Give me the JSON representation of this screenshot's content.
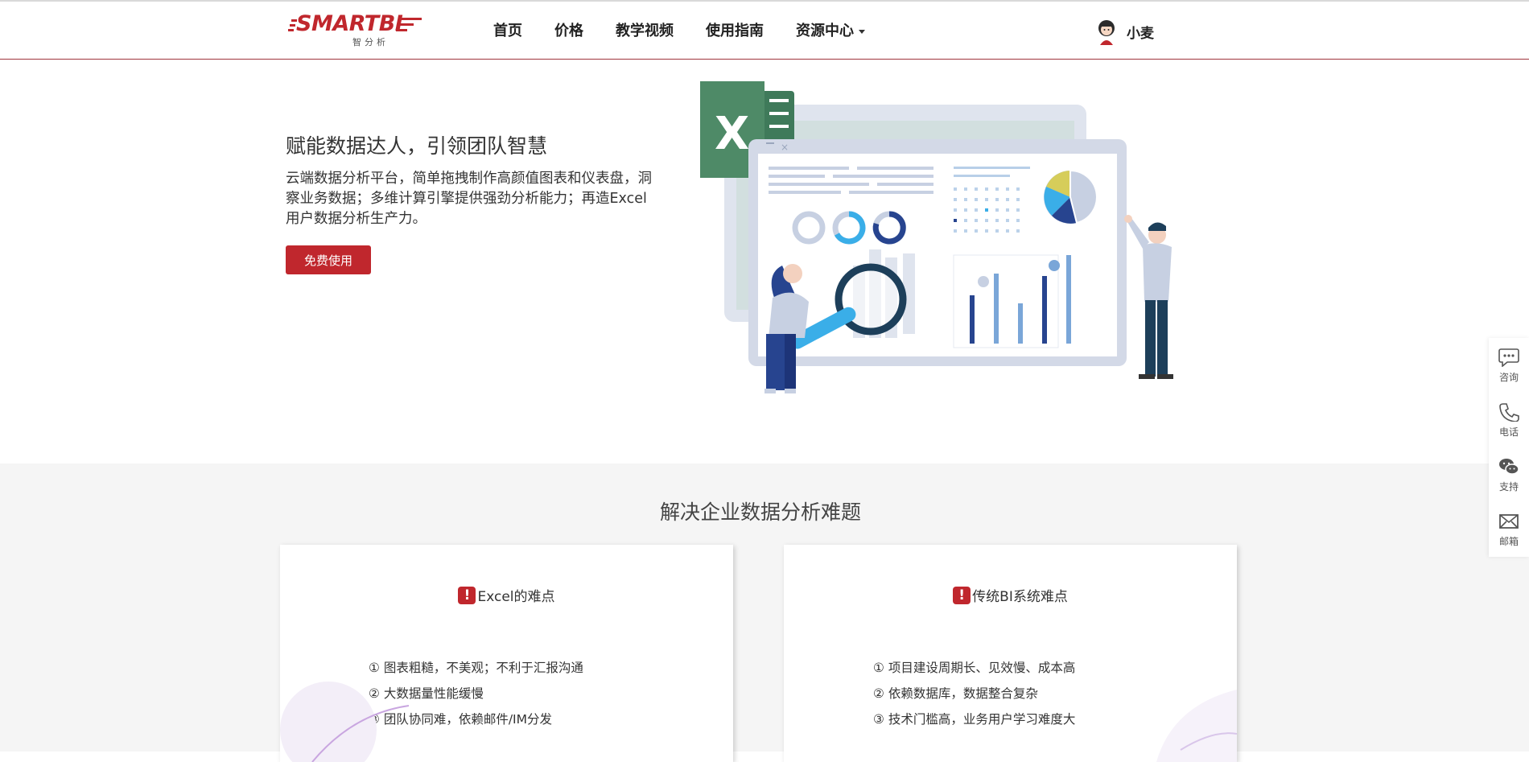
{
  "header": {
    "logo_text": "SMARTBI",
    "logo_sub": "智分析",
    "nav": [
      {
        "label": "首页"
      },
      {
        "label": "价格"
      },
      {
        "label": "教学视频"
      },
      {
        "label": "使用指南"
      },
      {
        "label": "资源中心"
      }
    ],
    "user_name": "小麦"
  },
  "hero": {
    "title": "赋能数据达人，引领团队智慧",
    "description": "云端数据分析平台，简单拖拽制作高颜值图表和仪表盘，洞察业务数据；多维计算引擎提供强劲分析能力；再造Excel用户数据分析生产力。",
    "button_label": "免费使用",
    "excel_icon_letter": "X"
  },
  "section": {
    "title": "解决企业数据分析难题",
    "cards": [
      {
        "title": "Excel的难点",
        "items": [
          "① 图表粗糙，不美观；不利于汇报沟通",
          "② 大数据量性能缓慢",
          "③ 团队协同难，依赖邮件/IM分发"
        ]
      },
      {
        "title": "传统BI系统难点",
        "items": [
          "① 项目建设周期长、见效慢、成本高",
          "② 依赖数据库，数据整合复杂",
          "③ 技术门槛高，业务用户学习难度大"
        ]
      }
    ]
  },
  "float_bar": [
    {
      "label": "咨询",
      "icon": "chat-icon"
    },
    {
      "label": "电话",
      "icon": "phone-icon"
    },
    {
      "label": "支持",
      "icon": "wechat-icon"
    },
    {
      "label": "邮箱",
      "icon": "mail-icon"
    }
  ],
  "colors": {
    "brand": "#c0272d",
    "section_bg": "#f5f5f5",
    "excel_green": "#4e8a67"
  }
}
